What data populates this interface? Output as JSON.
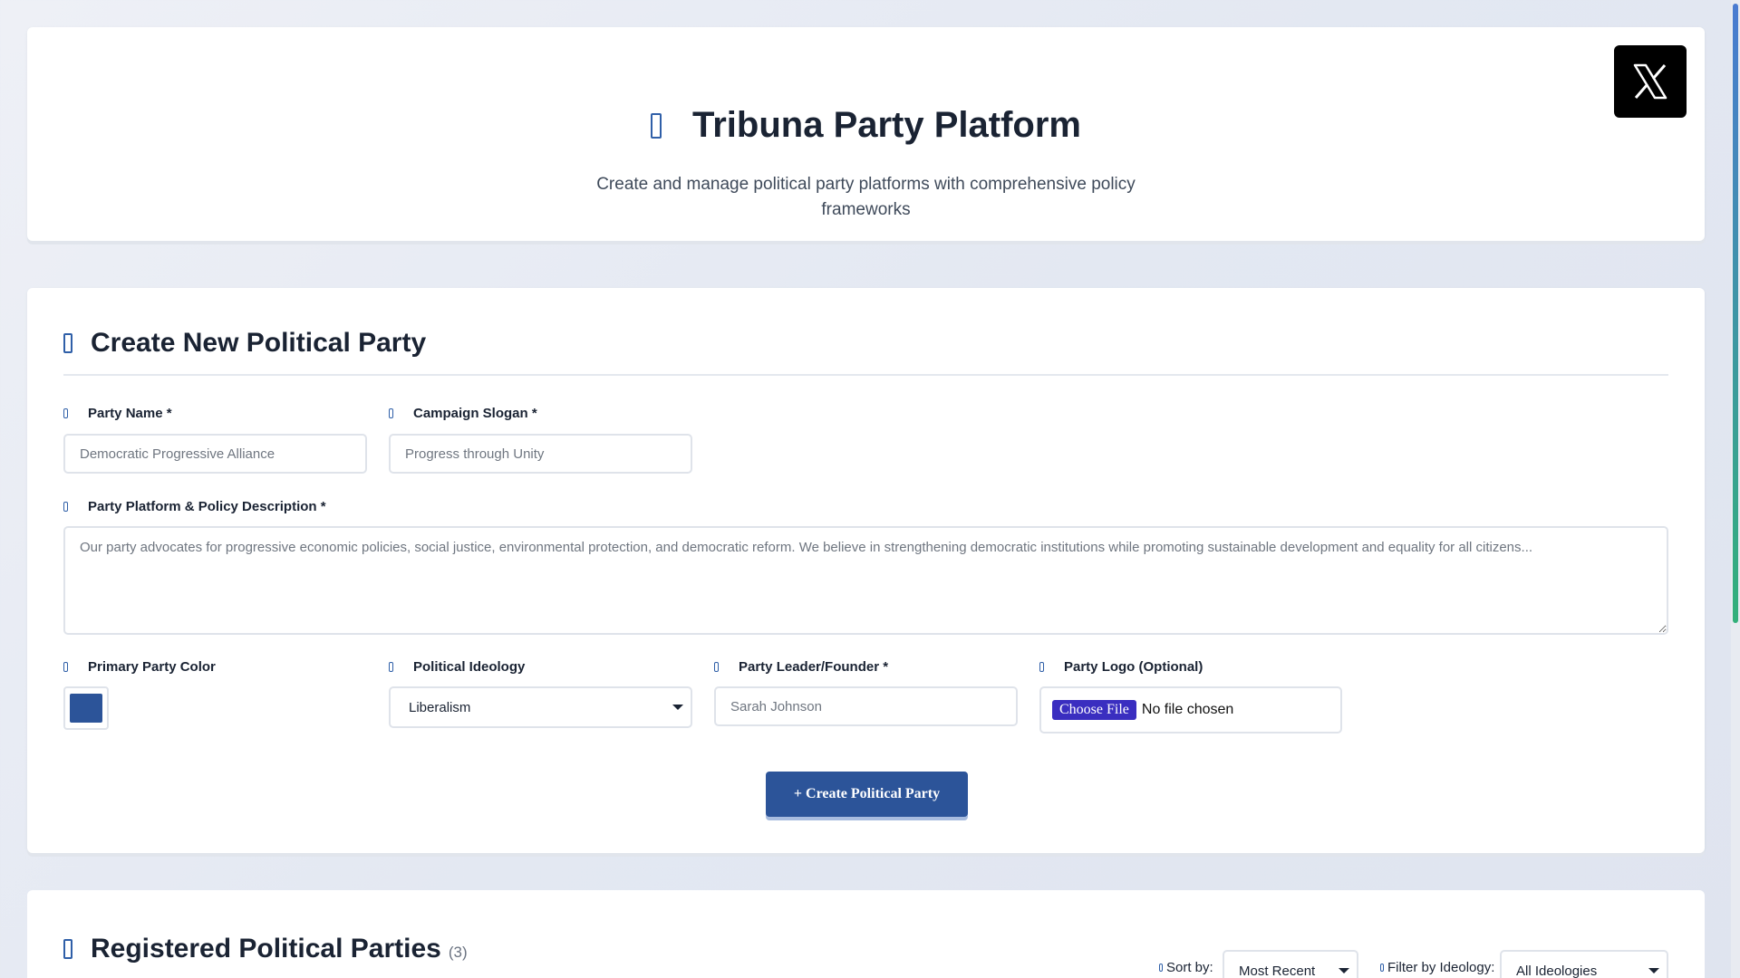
{
  "header": {
    "title": "Tribuna Party Platform",
    "subtitle_line1": "Create and manage political party platforms with comprehensive policy",
    "subtitle_line2": "frameworks",
    "title_icon": "landmark-icon",
    "x_button_icon": "x-logo-icon"
  },
  "form": {
    "title": "Create New Political Party",
    "party_name": {
      "label": "Party Name *",
      "placeholder": "Democratic Progressive Alliance"
    },
    "campaign_slogan": {
      "label": "Campaign Slogan *",
      "placeholder": "Progress through Unity"
    },
    "description": {
      "label": "Party Platform & Policy Description *",
      "placeholder": "Our party advocates for progressive economic policies, social justice, environmental protection, and democratic reform. We believe in strengthening democratic institutions while promoting sustainable development and equality for all citizens..."
    },
    "primary_color": {
      "label": "Primary Party Color",
      "value": "#2c5499"
    },
    "ideology": {
      "label": "Political Ideology",
      "value": "Liberalism"
    },
    "leader": {
      "label": "Party Leader/Founder *",
      "placeholder": "Sarah Johnson"
    },
    "logo": {
      "label": "Party Logo (Optional)",
      "button": "Choose File",
      "status": "No file chosen"
    },
    "submit_label": "+ Create Political Party"
  },
  "registered": {
    "title": "Registered Political Parties",
    "count": "(3)",
    "sort_label": "Sort by:",
    "sort_value": "Most Recent",
    "filter_label": "Filter by Ideology:",
    "filter_value": "All Ideologies"
  },
  "colors": {
    "accent": "#2c5499",
    "icon_blue": "#2f5fa8",
    "file_button": "#3a2ec0"
  }
}
